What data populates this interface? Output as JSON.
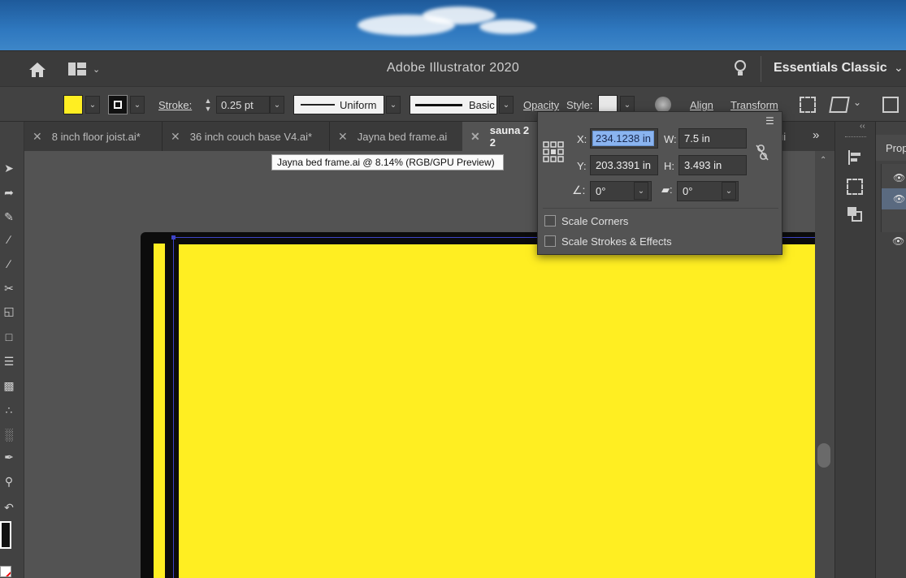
{
  "app": {
    "title": "Adobe Illustrator 2020",
    "workspace": "Essentials Classic"
  },
  "control": {
    "fill_color": "#ffee22",
    "stroke_label": "Stroke:",
    "stroke_weight": "0.25 pt",
    "profile_label": "Uniform",
    "brush_label": "Basic",
    "opacity_label": "Opacity",
    "style_label": "Style:",
    "align_label": "Align",
    "transform_label": "Transform"
  },
  "tabs": [
    {
      "label": "8 inch floor joist.ai*"
    },
    {
      "label": "36 inch couch base V4.ai*"
    },
    {
      "label": "Jayna bed frame.ai"
    },
    {
      "label": "sauna 2 2"
    },
    {
      "label": "ui"
    }
  ],
  "tooltip": "Jayna bed frame.ai @ 8.14% (RGB/GPU Preview)",
  "transform": {
    "x_label": "X:",
    "x_value": "234.1238 in",
    "w_label": "W:",
    "w_value": "7.5 in",
    "y_label": "Y:",
    "y_value": "203.3391 in",
    "h_label": "H:",
    "h_value": "3.493 in",
    "rotate_value": "0°",
    "shear_value": "0°",
    "scale_corners": "Scale Corners",
    "scale_strokes": "Scale Strokes & Effects"
  },
  "props_panel": {
    "tab_label": "Prop"
  },
  "colors": {
    "artwork_fill": "#ffee22",
    "selection": "#3d44c8",
    "accent_highlight": "#8ab4f0"
  }
}
